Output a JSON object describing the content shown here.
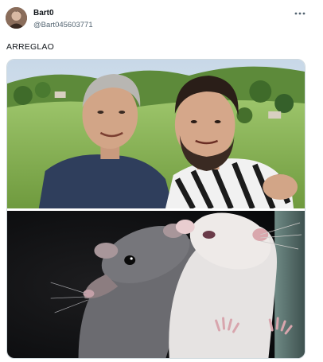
{
  "post": {
    "author_name": "Bart0",
    "author_handle": "@Bart045603771",
    "text": "ARREGLAO",
    "more_icon": "ellipsis-horizontal-icon"
  },
  "media": {
    "images": [
      {
        "name": "photo-two-men-outdoors"
      },
      {
        "name": "photo-two-rats"
      }
    ]
  }
}
